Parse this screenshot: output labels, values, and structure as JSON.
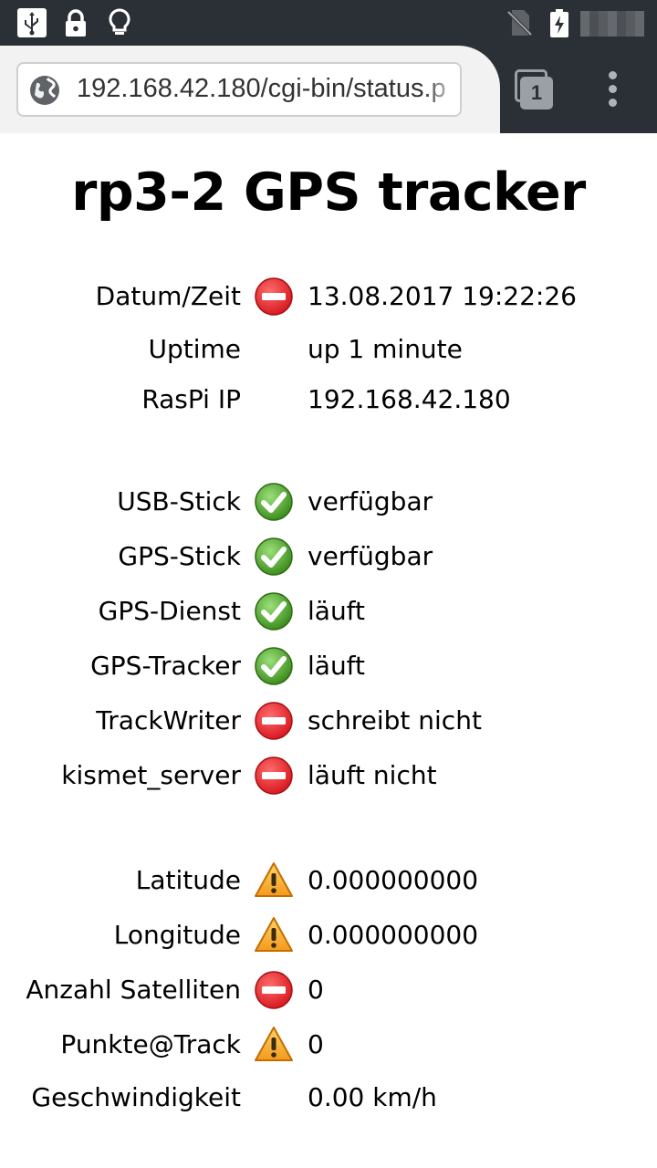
{
  "browser": {
    "url": "192.168.42.180/cgi-bin/status.p",
    "tab_count": "1"
  },
  "page": {
    "title": "rp3-2 GPS tracker"
  },
  "status_groups": [
    [
      {
        "label": "Datum/Zeit",
        "status": "error",
        "value": "13.08.2017 19:22:26"
      },
      {
        "label": "Uptime",
        "status": "none",
        "value": "up 1 minute"
      },
      {
        "label": "RasPi IP",
        "status": "none",
        "value": "192.168.42.180"
      }
    ],
    [
      {
        "label": "USB-Stick",
        "status": "ok",
        "value": "verfügbar"
      },
      {
        "label": "GPS-Stick",
        "status": "ok",
        "value": "verfügbar"
      },
      {
        "label": "GPS-Dienst",
        "status": "ok",
        "value": "läuft"
      },
      {
        "label": "GPS-Tracker",
        "status": "ok",
        "value": "läuft"
      },
      {
        "label": "TrackWriter",
        "status": "error",
        "value": "schreibt nicht"
      },
      {
        "label": "kismet_server",
        "status": "error",
        "value": "läuft nicht"
      }
    ],
    [
      {
        "label": "Latitude",
        "status": "warning",
        "value": "0.000000000"
      },
      {
        "label": "Longitude",
        "status": "warning",
        "value": "0.000000000"
      },
      {
        "label": "Anzahl Satelliten",
        "status": "error",
        "value": "0"
      },
      {
        "label": "Punkte@Track",
        "status": "warning",
        "value": "0"
      },
      {
        "label": "Geschwindigkeit",
        "status": "none",
        "value": "0.00 km/h"
      }
    ]
  ],
  "colors": {
    "error": "#d81b22",
    "ok": "#3e8e1f",
    "warning": "#f39a1c",
    "statusbar": "#2b3036"
  },
  "icons": {
    "error": "no-entry-icon",
    "ok": "checkmark-icon",
    "warning": "warning-triangle-icon"
  }
}
